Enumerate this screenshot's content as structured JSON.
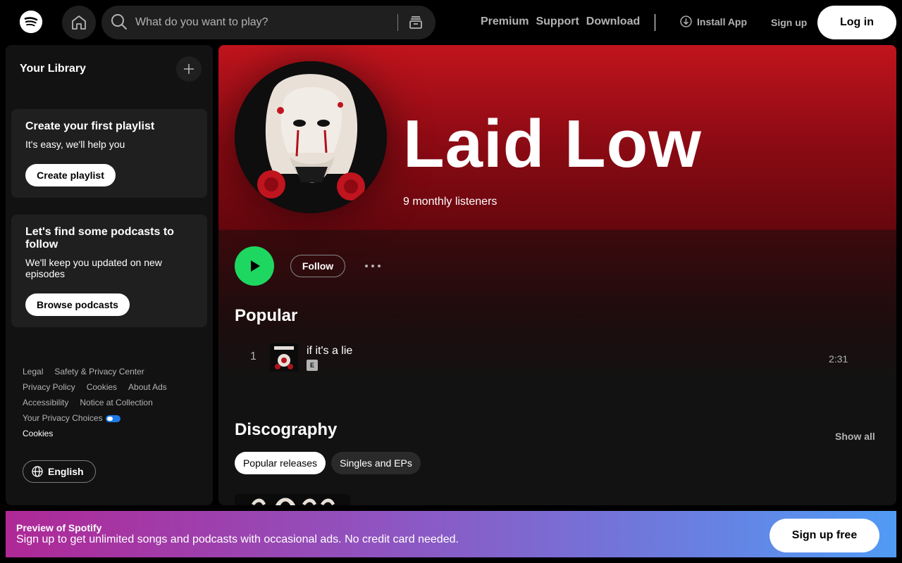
{
  "topbar": {
    "search_placeholder": "What do you want to play?",
    "links": [
      "Premium",
      "Support",
      "Download"
    ],
    "install_label": "Install App",
    "signup_label": "Sign up",
    "login_label": "Log in"
  },
  "sidebar": {
    "title": "Your Library",
    "card1": {
      "title": "Create your first playlist",
      "subtitle": "It's easy, we'll help you",
      "button": "Create playlist"
    },
    "card2": {
      "title": "Let's find some podcasts to follow",
      "subtitle": "We'll keep you updated on new episodes",
      "button": "Browse podcasts"
    },
    "legal": {
      "legal": "Legal",
      "safety": "Safety & Privacy Center",
      "privacy_policy": "Privacy Policy",
      "cookies": "Cookies",
      "about_ads": "About Ads",
      "accessibility": "Accessibility",
      "notice": "Notice at Collection",
      "privacy_choices": "Your Privacy Choices",
      "cookies_bottom": "Cookies"
    },
    "language": "English"
  },
  "artist": {
    "name": "Laid Low",
    "listeners": "9 monthly listeners",
    "follow_label": "Follow",
    "popular_heading": "Popular",
    "tracks": [
      {
        "num": "1",
        "title": "if it's a lie",
        "explicit": "E",
        "duration": "2:31"
      }
    ],
    "discography_heading": "Discography",
    "show_all": "Show all",
    "filters": [
      "Popular releases",
      "Singles and EPs"
    ]
  },
  "banner": {
    "title": "Preview of Spotify",
    "subtitle": "Sign up to get unlimited songs and podcasts with occasional ads. No credit card needed.",
    "button": "Sign up free"
  },
  "colors": {
    "accent_green": "#1ed760",
    "header_red": "#c1141d",
    "banner_start": "#af2896",
    "banner_end": "#509bf5"
  },
  "icons": [
    "spotify-logo-icon",
    "home-icon",
    "search-icon",
    "browse-icon",
    "download-circle-icon",
    "plus-icon",
    "globe-icon",
    "play-icon",
    "more-icon"
  ]
}
